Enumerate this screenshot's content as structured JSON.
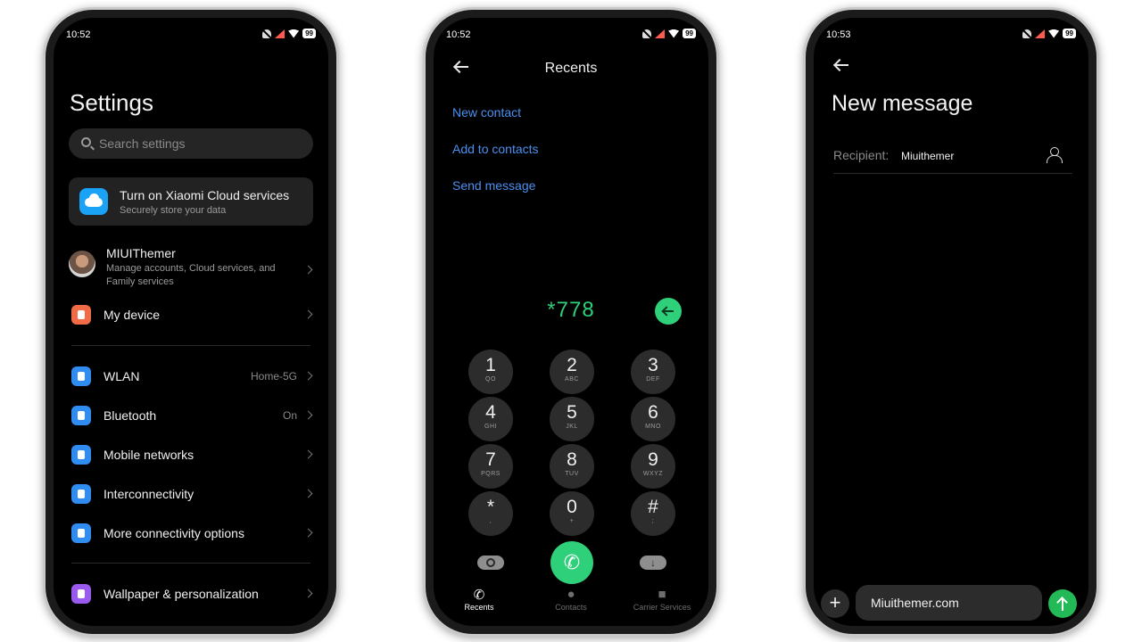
{
  "phone1": {
    "status": {
      "time": "10:52",
      "battery": "99"
    },
    "title": "Settings",
    "search": {
      "placeholder": "Search settings"
    },
    "cloud": {
      "title": "Turn on Xiaomi Cloud services",
      "subtitle": "Securely store your data",
      "icon": "cloud-icon"
    },
    "account": {
      "name": "MIUIThemer",
      "description": "Manage accounts, Cloud services, and Family services"
    },
    "rows": [
      {
        "label": "My device",
        "value": "",
        "icon": "device-icon",
        "color": "#f26b47"
      },
      {
        "label": "WLAN",
        "value": "Home-5G",
        "icon": "wifi-icon",
        "color": "#2f8cf0"
      },
      {
        "label": "Bluetooth",
        "value": "On",
        "icon": "bluetooth-icon",
        "color": "#2f8cf0"
      },
      {
        "label": "Mobile networks",
        "value": "",
        "icon": "sim-icon",
        "color": "#2f8cf0"
      },
      {
        "label": "Interconnectivity",
        "value": "",
        "icon": "interconnect-icon",
        "color": "#2f8cf0"
      },
      {
        "label": "More connectivity options",
        "value": "",
        "icon": "connectivity-icon",
        "color": "#2f8cf0"
      },
      {
        "label": "Wallpaper & personalization",
        "value": "",
        "icon": "wallpaper-icon",
        "color": "#9a5af0"
      }
    ]
  },
  "phone2": {
    "status": {
      "time": "10:52",
      "battery": "99"
    },
    "title": "Recents",
    "links": [
      "New contact",
      "Add to contacts",
      "Send message"
    ],
    "number": "*778",
    "keys": [
      {
        "digit": "1",
        "sub": "QO"
      },
      {
        "digit": "2",
        "sub": "ABC"
      },
      {
        "digit": "3",
        "sub": "DEF"
      },
      {
        "digit": "4",
        "sub": "GHI"
      },
      {
        "digit": "5",
        "sub": "JKL"
      },
      {
        "digit": "6",
        "sub": "MNO"
      },
      {
        "digit": "7",
        "sub": "PQRS"
      },
      {
        "digit": "8",
        "sub": "TUV"
      },
      {
        "digit": "9",
        "sub": "WXYZ"
      },
      {
        "digit": "*",
        "sub": ","
      },
      {
        "digit": "0",
        "sub": "+"
      },
      {
        "digit": "#",
        "sub": ";"
      }
    ],
    "tabs": [
      "Recents",
      "Contacts",
      "Carrier Services"
    ]
  },
  "phone3": {
    "status": {
      "time": "10:53",
      "battery": "99"
    },
    "title": "New message",
    "recipient_label": "Recipient:",
    "recipient_value": "Miuithemer",
    "message_value": "Miuithemer.com"
  }
}
